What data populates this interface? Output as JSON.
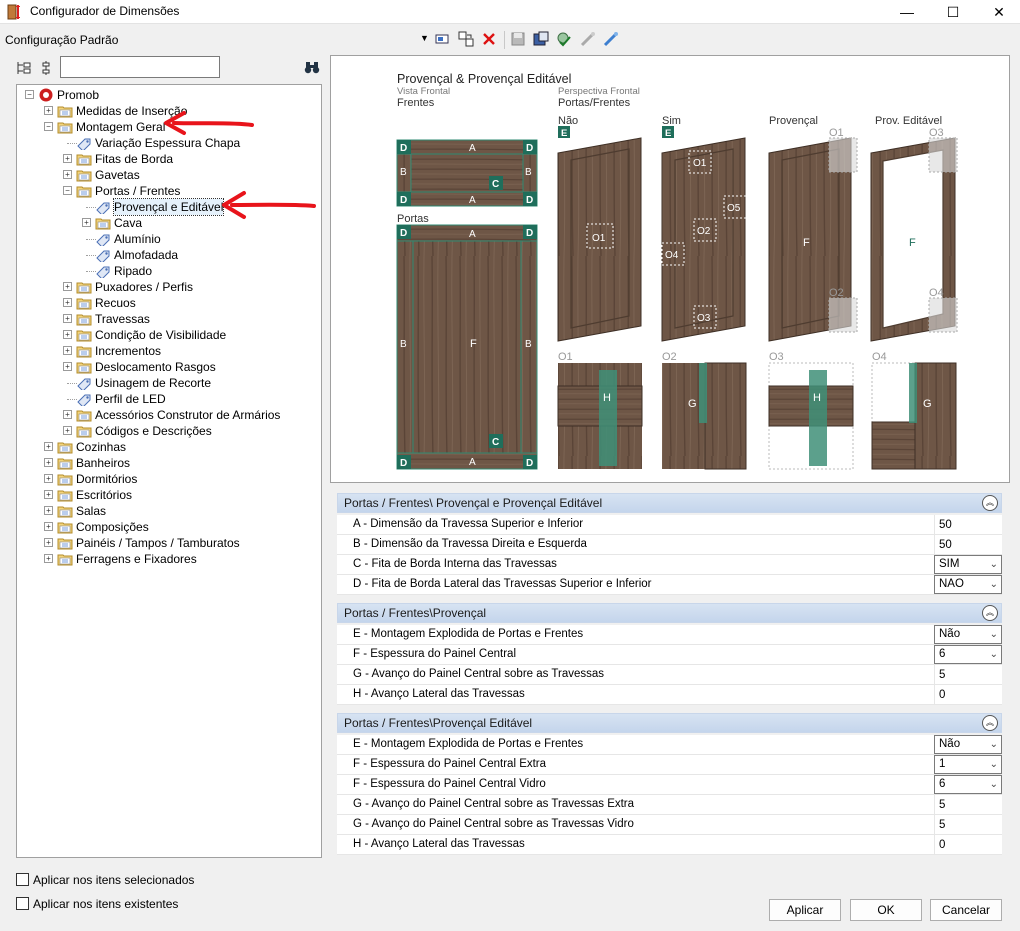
{
  "window": {
    "title": "Configurador de Dimensões",
    "minimize": "—",
    "maximize": "☐",
    "close": "✕"
  },
  "toolbar": {
    "config_label": "Configuração Padrão",
    "dropdown_arrow": "▼"
  },
  "search": {
    "value": "",
    "placeholder": ""
  },
  "tree": [
    {
      "id": "promob",
      "label": "Promob",
      "level": 0,
      "expander": "minus",
      "icon": "promob-icon"
    },
    {
      "id": "medidas",
      "label": "Medidas de Inserção",
      "level": 1,
      "expander": "plus",
      "icon": "folder-icon"
    },
    {
      "id": "montagem",
      "label": "Montagem Geral",
      "level": 1,
      "expander": "minus",
      "icon": "folder-icon"
    },
    {
      "id": "variacao",
      "label": "Variação Espessura Chapa",
      "level": 2,
      "expander": "none",
      "icon": "tag-icon"
    },
    {
      "id": "fitas",
      "label": "Fitas de Borda",
      "level": 2,
      "expander": "plus",
      "icon": "folder-icon"
    },
    {
      "id": "gavetas",
      "label": "Gavetas",
      "level": 2,
      "expander": "plus",
      "icon": "folder-icon"
    },
    {
      "id": "portas",
      "label": "Portas / Frentes",
      "level": 2,
      "expander": "minus",
      "icon": "folder-icon"
    },
    {
      "id": "provencal",
      "label": "Provençal e Editável",
      "level": 3,
      "expander": "none",
      "icon": "tag-icon",
      "selected": true
    },
    {
      "id": "cava",
      "label": "Cava",
      "level": 3,
      "expander": "plus",
      "icon": "folder-icon"
    },
    {
      "id": "aluminio",
      "label": "Alumínio",
      "level": 3,
      "expander": "none",
      "icon": "tag-icon"
    },
    {
      "id": "almofadada",
      "label": "Almofadada",
      "level": 3,
      "expander": "none",
      "icon": "tag-icon"
    },
    {
      "id": "ripado",
      "label": "Ripado",
      "level": 3,
      "expander": "none",
      "icon": "tag-icon"
    },
    {
      "id": "puxadores",
      "label": "Puxadores / Perfis",
      "level": 2,
      "expander": "plus",
      "icon": "folder-icon"
    },
    {
      "id": "recuos",
      "label": "Recuos",
      "level": 2,
      "expander": "plus",
      "icon": "folder-icon"
    },
    {
      "id": "travessas",
      "label": "Travessas",
      "level": 2,
      "expander": "plus",
      "icon": "folder-icon"
    },
    {
      "id": "condicao",
      "label": "Condição de Visibilidade",
      "level": 2,
      "expander": "plus",
      "icon": "folder-icon"
    },
    {
      "id": "incrementos",
      "label": "Incrementos",
      "level": 2,
      "expander": "plus",
      "icon": "folder-icon"
    },
    {
      "id": "deslocamento",
      "label": "Deslocamento Rasgos",
      "level": 2,
      "expander": "plus",
      "icon": "folder-icon"
    },
    {
      "id": "usinagem",
      "label": "Usinagem de Recorte",
      "level": 2,
      "expander": "none",
      "icon": "tag-icon"
    },
    {
      "id": "perfil",
      "label": "Perfil de LED",
      "level": 2,
      "expander": "none",
      "icon": "tag-icon"
    },
    {
      "id": "acessorios",
      "label": "Acessórios Construtor de Armários",
      "level": 2,
      "expander": "plus",
      "icon": "folder-icon"
    },
    {
      "id": "codigos",
      "label": "Códigos e Descrições",
      "level": 2,
      "expander": "plus",
      "icon": "folder-icon"
    },
    {
      "id": "cozinhas",
      "label": "Cozinhas",
      "level": 1,
      "expander": "plus",
      "icon": "folder-icon"
    },
    {
      "id": "banheiros",
      "label": "Banheiros",
      "level": 1,
      "expander": "plus",
      "icon": "folder-icon"
    },
    {
      "id": "dormitorios",
      "label": "Dormitórios",
      "level": 1,
      "expander": "plus",
      "icon": "folder-icon"
    },
    {
      "id": "escritorios",
      "label": "Escritórios",
      "level": 1,
      "expander": "plus",
      "icon": "folder-icon"
    },
    {
      "id": "salas",
      "label": "Salas",
      "level": 1,
      "expander": "plus",
      "icon": "folder-icon"
    },
    {
      "id": "composicoes",
      "label": "Composições",
      "level": 1,
      "expander": "plus",
      "icon": "folder-icon"
    },
    {
      "id": "paineis",
      "label": "Painéis / Tampos / Tamburatos",
      "level": 1,
      "expander": "plus",
      "icon": "folder-icon"
    },
    {
      "id": "ferragens",
      "label": "Ferragens e Fixadores",
      "level": 1,
      "expander": "plus",
      "icon": "folder-icon"
    }
  ],
  "checkboxes": {
    "selected_items": "Aplicar nos itens selecionados",
    "existing_items": "Aplicar nos itens existentes"
  },
  "diagram": {
    "title": "Provençal & Provençal Editável",
    "vista_frontal": "Vista Frontal",
    "frentes": "Frentes",
    "perspectiva": "Perspectiva Frontal",
    "portas_frentes": "Portas/Frentes",
    "portas": "Portas",
    "nao": "Não",
    "sim": "Sim",
    "provencal": "Provençal",
    "prov_editavel": "Prov. Editável",
    "letters": {
      "A": "A",
      "B": "B",
      "C": "C",
      "D": "D",
      "E": "E",
      "F": "F",
      "G": "G",
      "H": "H"
    },
    "o_labels": {
      "o1": "O1",
      "o2": "O2",
      "o3": "O3",
      "o4": "O4",
      "o5": "O5"
    }
  },
  "sections": [
    {
      "title": "Portas / Frentes\\ Provençal e Provençal Editável",
      "collapse": "︽",
      "rows": [
        {
          "label": "A - Dimensão da Travessa Superior e Inferior",
          "value": "50",
          "type": "text"
        },
        {
          "label": "B - Dimensão da Travessa Direita e Esquerda",
          "value": "50",
          "type": "text"
        },
        {
          "label": "C - Fita de Borda Interna das Travessas",
          "value": "SIM",
          "type": "drop"
        },
        {
          "label": "D - Fita de Borda Lateral das Travessas Superior e Inferior",
          "value": "NAO",
          "type": "drop"
        }
      ]
    },
    {
      "title": "Portas / Frentes\\Provençal",
      "collapse": "︽",
      "rows": [
        {
          "label": "E - Montagem Explodida de Portas e Frentes",
          "value": "Não",
          "type": "drop"
        },
        {
          "label": "F - Espessura do Painel Central",
          "value": "6",
          "type": "drop"
        },
        {
          "label": "G - Avanço do Painel Central sobre as Travessas",
          "value": "5",
          "type": "text"
        },
        {
          "label": "H - Avanço Lateral das Travessas",
          "value": "0",
          "type": "text"
        }
      ]
    },
    {
      "title": "Portas / Frentes\\Provençal Editável",
      "collapse": "︽",
      "rows": [
        {
          "label": "E - Montagem Explodida de Portas e Frentes",
          "value": "Não",
          "type": "drop"
        },
        {
          "label": "F - Espessura do Painel Central Extra",
          "value": "1",
          "type": "drop"
        },
        {
          "label": "F - Espessura do Painel Central Vidro",
          "value": "6",
          "type": "drop"
        },
        {
          "label": "G - Avanço do Painel Central sobre as Travessas Extra",
          "value": "5",
          "type": "text"
        },
        {
          "label": "G - Avanço do Painel Central sobre as Travessas Vidro",
          "value": "5",
          "type": "text"
        },
        {
          "label": "H - Avanço Lateral das Travessas",
          "value": "0",
          "type": "text"
        }
      ]
    }
  ],
  "buttons": {
    "apply": "Aplicar",
    "ok": "OK",
    "cancel": "Cancelar"
  },
  "colors": {
    "wood": "#6b5443",
    "teal": "#1f6e5b",
    "section_bg": "#cfdcef",
    "arrow": "#e8141b"
  }
}
